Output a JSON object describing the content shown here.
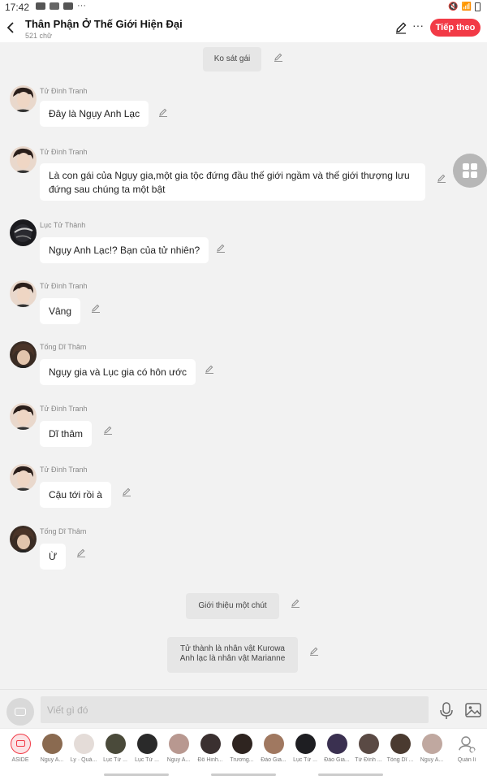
{
  "status_bar": {
    "time": "17:42",
    "dots": "···"
  },
  "header": {
    "title": "Thân Phận Ở Thế Giới Hiện Đại",
    "subtitle": "521 chữ",
    "next_label": "Tiếp theo",
    "more_label": "···"
  },
  "messages": [
    {
      "type": "narration",
      "text": "Ko sát gái"
    },
    {
      "type": "dialog",
      "sender": "Tử Đình Tranh",
      "avatar": "#5a4a44",
      "text": "Đây là Ngụy Anh Lạc"
    },
    {
      "type": "dialog",
      "sender": "Tử Đình Tranh",
      "avatar": "#5a4a44",
      "text": "Là con gái của Ngụy gia,một gia tộc đứng đầu thế giới ngầm và thế giới thượng lưu đứng sau chúng ta một bật"
    },
    {
      "type": "dialog",
      "sender": "Lục Tử Thành",
      "avatar": "#1e1e22",
      "text": "Ngụy Anh Lạc!? Bạn của tử nhiên?"
    },
    {
      "type": "dialog",
      "sender": "Tử Đình Tranh",
      "avatar": "#5a4a44",
      "text": "Vâng"
    },
    {
      "type": "dialog",
      "sender": "Tống Dĩ Thâm",
      "avatar": "#4a3a30",
      "text": "Ngụy gia và Lục gia có hôn ước"
    },
    {
      "type": "dialog",
      "sender": "Tử Đình Tranh",
      "avatar": "#5a4a44",
      "text": "Dĩ thâm"
    },
    {
      "type": "dialog",
      "sender": "Tử Đình Tranh",
      "avatar": "#5a4a44",
      "text": "Cậu tới rồi à"
    },
    {
      "type": "dialog",
      "sender": "Tống Dĩ Thâm",
      "avatar": "#4a3a30",
      "text": "Ừ"
    },
    {
      "type": "narration",
      "text": "Giới thiệu một chút"
    },
    {
      "type": "narration",
      "line1": "Tử thành là nhân vật Kurowa",
      "line2": "Anh lạc là nhân vật Marianne"
    }
  ],
  "composer": {
    "placeholder": "Viết gì đó"
  },
  "characters": [
    {
      "name": "ASIDE"
    },
    {
      "name": "Nguy A...",
      "color": "#8a6a50"
    },
    {
      "name": "Ly · Quả...",
      "color": "#d8d0cc"
    },
    {
      "name": "Lục Tử ...",
      "color": "#4a4a3a"
    },
    {
      "name": "Lục Tử ...",
      "color": "#2a2a2a"
    },
    {
      "name": "Nguy A...",
      "color": "#b89890"
    },
    {
      "name": "Đỗ Hinh...",
      "color": "#3a3030"
    },
    {
      "name": "Trương...",
      "color": "#2e2420"
    },
    {
      "name": "Đào Gia...",
      "color": "#a07860"
    },
    {
      "name": "Lục Tử ...",
      "color": "#1e1e22"
    },
    {
      "name": "Đào Gia...",
      "color": "#3a3050"
    },
    {
      "name": "Tử Đình ...",
      "color": "#5a4a44"
    },
    {
      "name": "Tống Dĩ ...",
      "color": "#4a3a30"
    },
    {
      "name": "Nguy A...",
      "color": "#c0a8a0"
    },
    {
      "name": "Quản lí"
    }
  ],
  "colors": {
    "accent": "#f23a46",
    "background": "#f2f2f2",
    "bubble": "#ffffff",
    "narration": "#e6e6e6"
  }
}
